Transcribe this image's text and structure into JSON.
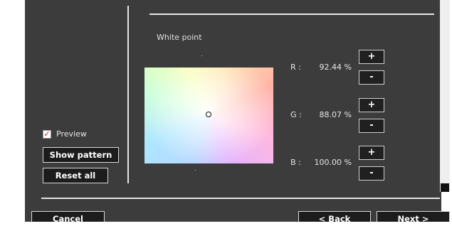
{
  "white_point": {
    "label": "White point"
  },
  "channels": [
    {
      "label": "R :",
      "value": "92.44 %",
      "plus": "+",
      "minus": "-"
    },
    {
      "label": "G :",
      "value": "88.07 %",
      "plus": "+",
      "minus": "-"
    },
    {
      "label": "B :",
      "value": "100.00 %",
      "plus": "+",
      "minus": "-"
    }
  ],
  "preview": {
    "checked": true,
    "check_glyph": "✓",
    "label": "Preview"
  },
  "buttons": {
    "show_pattern": "Show pattern",
    "reset_all": "Reset all",
    "cancel": "Cancel",
    "back": "< Back",
    "next": "Next >"
  },
  "colors": {
    "panel_bg": "#3c3c3c",
    "button_bg": "#1c1c1c",
    "check_mark": "#dd1111"
  }
}
